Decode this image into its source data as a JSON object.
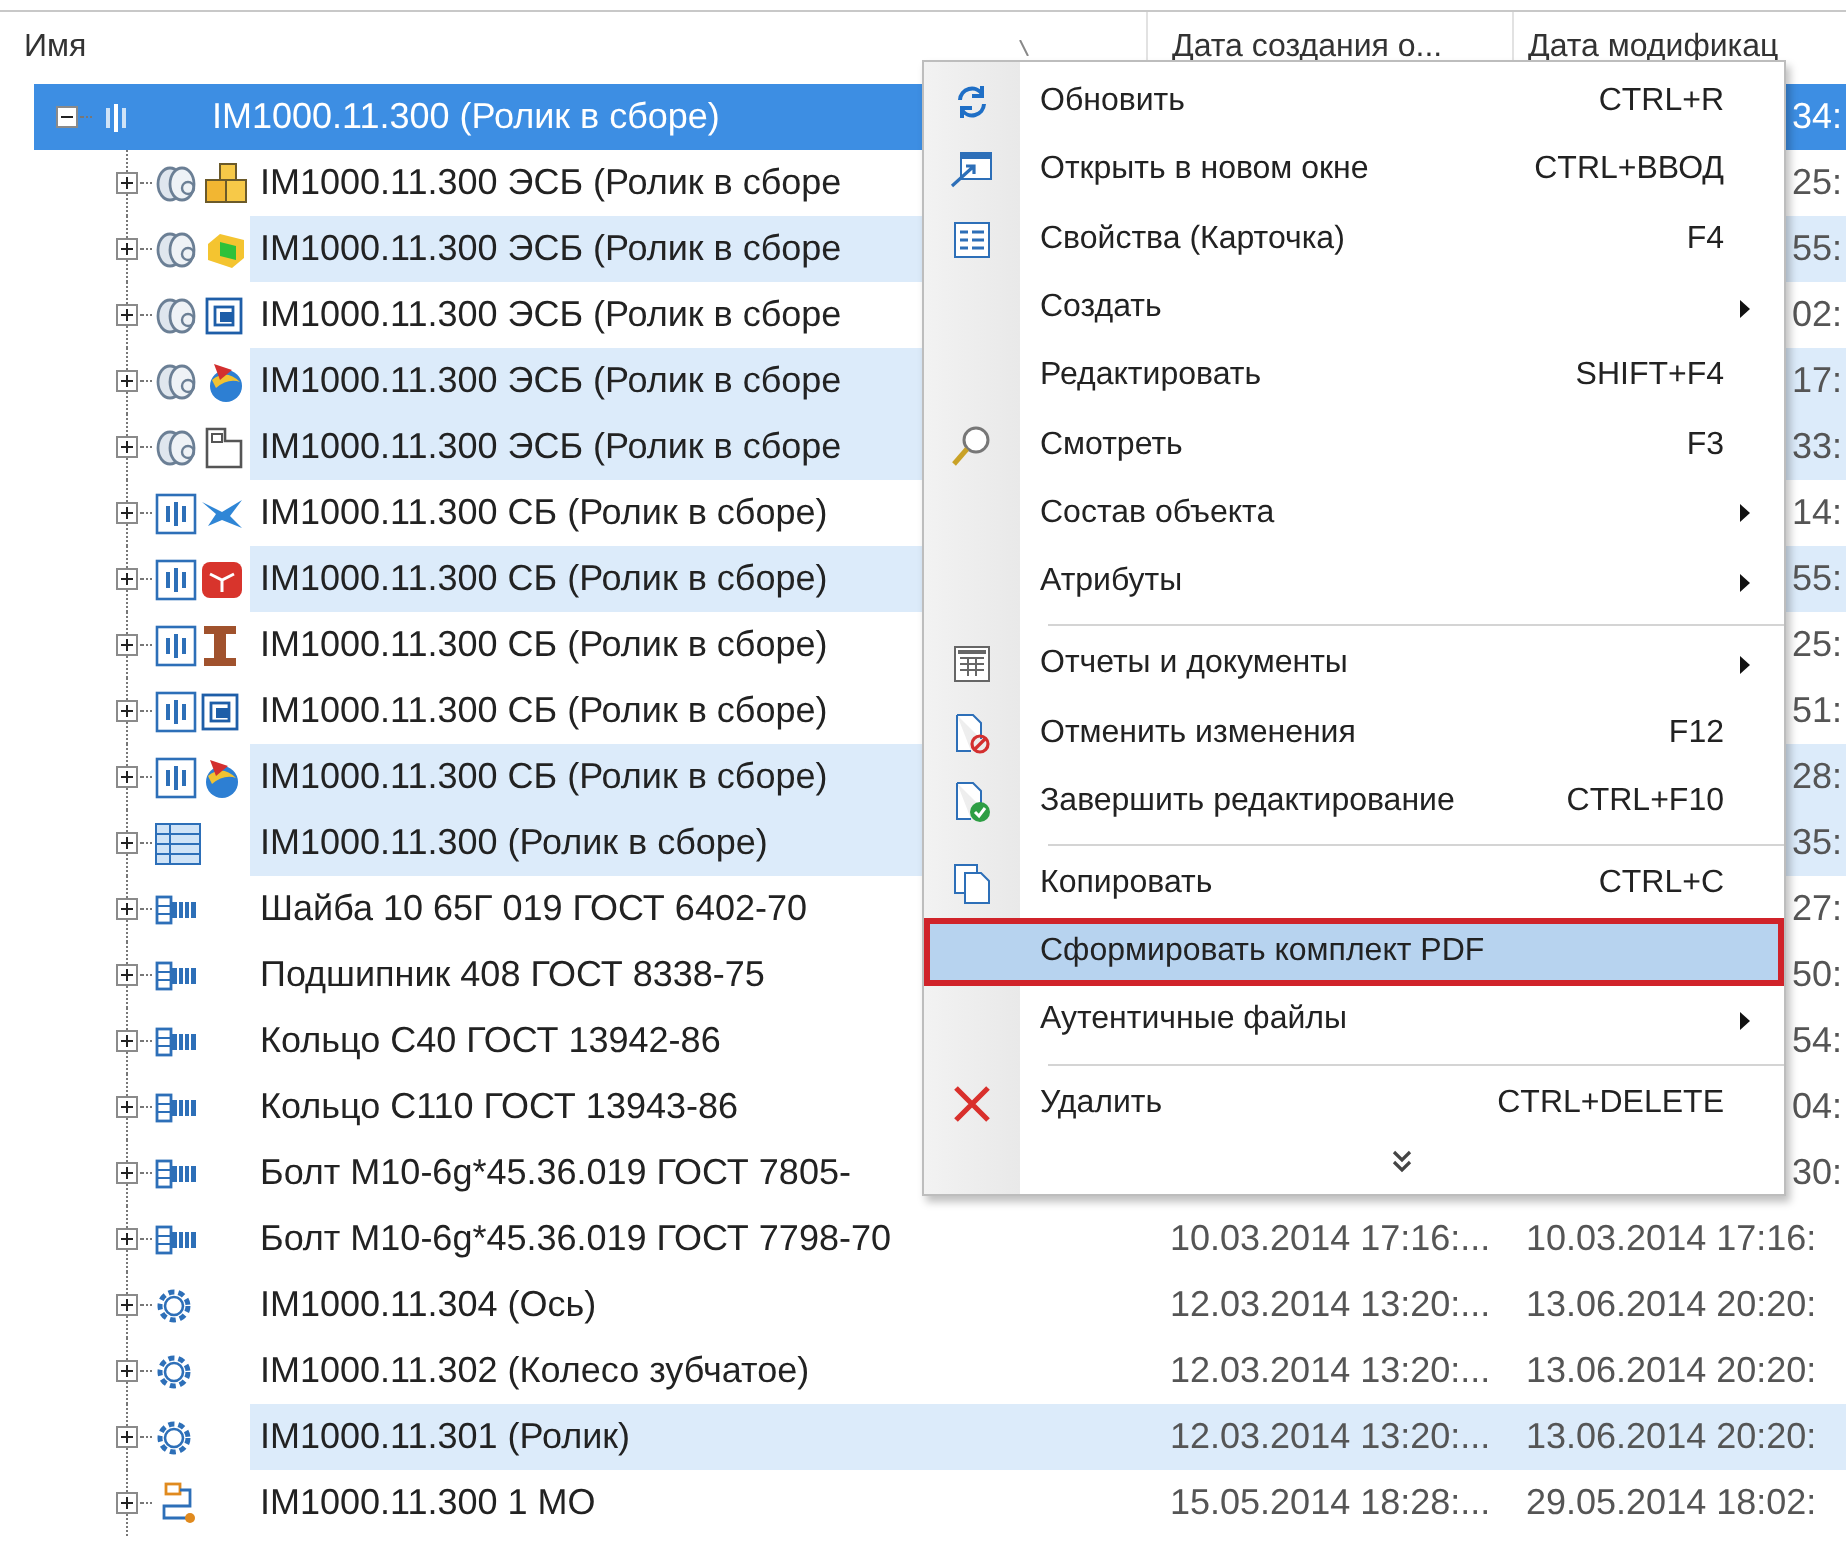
{
  "columns": [
    {
      "label": "Имя"
    },
    {
      "label": "Дата создания о..."
    },
    {
      "label": "Дата модификац"
    }
  ],
  "tree": [
    {
      "name": "IM1000.11.300 (Ролик в сборе)",
      "expanded": true,
      "selected": true,
      "modified": "34:",
      "children": [
        {
          "name": "IM1000.11.300 ЭСБ (Ролик в сборе",
          "expanded": false,
          "selected": false,
          "highlighted": false,
          "modified": "25:"
        },
        {
          "name": "IM1000.11.300 ЭСБ (Ролик в сборе",
          "expanded": false,
          "selected": false,
          "highlighted": true,
          "modified": "55:"
        },
        {
          "name": "IM1000.11.300 ЭСБ (Ролик в сборе",
          "expanded": false,
          "selected": false,
          "highlighted": false,
          "modified": "02:"
        },
        {
          "name": "IM1000.11.300 ЭСБ (Ролик в сборе",
          "expanded": false,
          "selected": false,
          "highlighted": true,
          "modified": "17:"
        },
        {
          "name": "IM1000.11.300 ЭСБ (Ролик в сборе",
          "expanded": false,
          "selected": false,
          "highlighted": true,
          "modified": "33:"
        },
        {
          "name": "IM1000.11.300 СБ (Ролик в сборе)",
          "expanded": false,
          "selected": false,
          "highlighted": false,
          "modified": "14:"
        },
        {
          "name": "IM1000.11.300 СБ (Ролик в сборе)",
          "expanded": false,
          "selected": false,
          "highlighted": true,
          "modified": "55:"
        },
        {
          "name": "IM1000.11.300 СБ (Ролик в сборе)",
          "expanded": false,
          "selected": false,
          "highlighted": false,
          "modified": "25:"
        },
        {
          "name": "IM1000.11.300 СБ (Ролик в сборе)",
          "expanded": false,
          "selected": false,
          "highlighted": false,
          "modified": "51:"
        },
        {
          "name": "IM1000.11.300 СБ (Ролик в сборе)",
          "expanded": false,
          "selected": false,
          "highlighted": true,
          "modified": "28:"
        },
        {
          "name": "IM1000.11.300 (Ролик в сборе)",
          "expanded": false,
          "selected": false,
          "highlighted": true,
          "modified": "35:"
        },
        {
          "name": "Шайба 10 65Г 019 ГОСТ 6402-70",
          "expanded": false,
          "selected": false,
          "highlighted": false,
          "modified": "27:"
        },
        {
          "name": "Подшипник 408 ГОСТ 8338-75",
          "expanded": false,
          "selected": false,
          "highlighted": false,
          "modified": "50:"
        },
        {
          "name": "Кольцо С40 ГОСТ 13942-86",
          "expanded": false,
          "selected": false,
          "highlighted": false,
          "modified": "54:"
        },
        {
          "name": "Кольцо С110 ГОСТ 13943-86",
          "expanded": false,
          "selected": false,
          "highlighted": false,
          "modified": "04:"
        },
        {
          "name": "Болт М10-6g*45.36.019 ГОСТ 7805-",
          "expanded": false,
          "selected": false,
          "highlighted": false,
          "modified": "30:"
        },
        {
          "name": "Болт М10-6g*45.36.019 ГОСТ 7798-70",
          "expanded": false,
          "selected": false,
          "highlighted": false,
          "created": "10.03.2014 17:16:...",
          "modified": "10.03.2014 17:16:"
        },
        {
          "name": "IM1000.11.304 (Ось)",
          "expanded": false,
          "selected": false,
          "highlighted": false,
          "created": "12.03.2014 13:20:...",
          "modified": "13.06.2014 20:20:"
        },
        {
          "name": "IM1000.11.302 (Колесо зубчатое)",
          "expanded": false,
          "selected": false,
          "highlighted": false,
          "created": "12.03.2014 13:20:...",
          "modified": "13.06.2014 20:20:"
        },
        {
          "name": "IM1000.11.301 (Ролик)",
          "expanded": false,
          "selected": false,
          "highlighted": true,
          "created": "12.03.2014 13:20:...",
          "modified": "13.06.2014 20:20:"
        },
        {
          "name": "IM1000.11.300 1 МО",
          "expanded": false,
          "selected": false,
          "highlighted": false,
          "created": "15.05.2014 18:28:...",
          "modified": "29.05.2014 18:02:"
        }
      ]
    }
  ],
  "menu": {
    "items": [
      {
        "label": "Обновить",
        "shortcut": "CTRL+R",
        "submenu": false,
        "separator_before": false,
        "selected": false,
        "annotated": false
      },
      {
        "label": "Открыть в новом окне",
        "shortcut": "CTRL+ВВОД",
        "submenu": false,
        "separator_before": false,
        "selected": false,
        "annotated": false
      },
      {
        "label": "Свойства (Карточка)",
        "shortcut": "F4",
        "submenu": false,
        "separator_before": false,
        "selected": false,
        "annotated": false
      },
      {
        "label": "Создать",
        "submenu": true,
        "separator_before": false,
        "selected": false,
        "annotated": false
      },
      {
        "label": "Редактировать",
        "shortcut": "SHIFT+F4",
        "submenu": false,
        "separator_before": false,
        "selected": false,
        "annotated": false
      },
      {
        "label": "Смотреть",
        "shortcut": "F3",
        "submenu": false,
        "separator_before": false,
        "selected": false,
        "annotated": false
      },
      {
        "label": "Состав объекта",
        "submenu": true,
        "separator_before": false,
        "selected": false,
        "annotated": false
      },
      {
        "label": "Атрибуты",
        "submenu": true,
        "separator_before": false,
        "selected": false,
        "annotated": false
      },
      {
        "label": "Отчеты и документы",
        "submenu": true,
        "separator_before": true,
        "selected": false,
        "annotated": false
      },
      {
        "label": "Отменить изменения",
        "shortcut": "F12",
        "submenu": false,
        "separator_before": false,
        "selected": false,
        "annotated": false
      },
      {
        "label": "Завершить редактирование",
        "shortcut": "CTRL+F10",
        "submenu": false,
        "separator_before": false,
        "selected": false,
        "annotated": false
      },
      {
        "label": "Копировать",
        "shortcut": "CTRL+C",
        "submenu": false,
        "separator_before": true,
        "selected": false,
        "annotated": false
      },
      {
        "label": "Сформировать комплект PDF",
        "submenu": false,
        "separator_before": false,
        "selected": true,
        "annotated": true
      },
      {
        "label": "Аутентичные файлы",
        "submenu": true,
        "separator_before": false,
        "selected": false,
        "annotated": false
      },
      {
        "label": "Удалить",
        "shortcut": "CTRL+DELETE",
        "submenu": false,
        "separator_before": true,
        "selected": false,
        "annotated": false
      }
    ]
  }
}
